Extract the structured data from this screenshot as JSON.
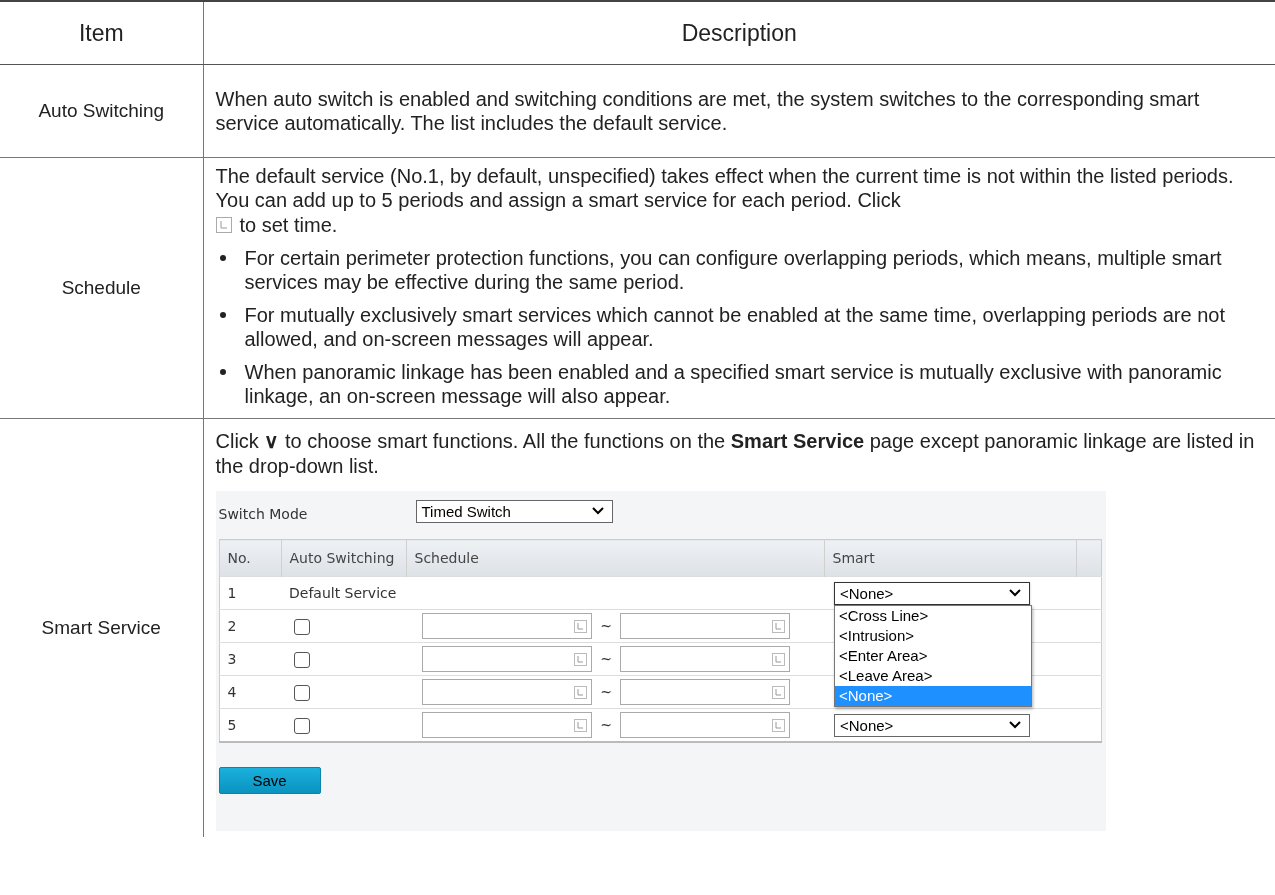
{
  "table": {
    "columns": [
      "Item",
      "Description"
    ],
    "rows": [
      {
        "kind": "plain",
        "item": "Auto Switching",
        "text": "When auto switch is enabled and switching conditions are met, the system switches to the corresponding smart service automatically. The list includes the default service."
      },
      {
        "kind": "schedule",
        "item": "Schedule",
        "text_before": "The default service (No.1, by default, unspecified) takes effect when the current time is not within the listed periods. You can add up to 5 periods and assign a smart service for each period. Click",
        "text_after": "to set time.",
        "bullets": [
          "For certain perimeter protection functions, you can configure overlapping periods, which means, multiple smart services may be effective during the same period.",
          "For mutually exclusively smart services which cannot be enabled at the same time, overlapping periods are not allowed, and on-screen messages will appear.",
          "When panoramic linkage has been enabled and a specified smart service is mutually exclusive with panoramic linkage, an on-screen message will also appear."
        ]
      },
      {
        "kind": "smart",
        "item": "Smart Service",
        "text": "Click **∨** to choose smart functions. All the functions on the **Smart Service** page except panoramic linkage are listed in the drop-down list."
      }
    ]
  },
  "screenshot": {
    "switch_mode_label": "Switch Mode",
    "switch_mode_value": "Timed Switch",
    "columns": [
      "No.",
      "Auto Switching",
      "Schedule",
      "Smart"
    ],
    "rows": [
      {
        "kind": "default",
        "no": "1",
        "label": "Default Service",
        "smart": "<None>",
        "dropdown_open": true
      },
      {
        "kind": "period",
        "no": "2",
        "checked": false,
        "separator": "~"
      },
      {
        "kind": "period",
        "no": "3",
        "checked": false,
        "separator": "~"
      },
      {
        "kind": "period",
        "no": "4",
        "checked": false,
        "separator": "~"
      },
      {
        "kind": "period",
        "no": "5",
        "checked": false,
        "separator": "~",
        "smart": "<None>"
      }
    ],
    "dropdown_options": [
      {
        "label": "<Cross Line>",
        "selected": false
      },
      {
        "label": "<Intrusion>",
        "selected": false
      },
      {
        "label": "<Enter Area>",
        "selected": false
      },
      {
        "label": "<Leave Area>",
        "selected": false
      },
      {
        "label": "<None>",
        "selected": true
      }
    ],
    "save_button": "Save"
  }
}
